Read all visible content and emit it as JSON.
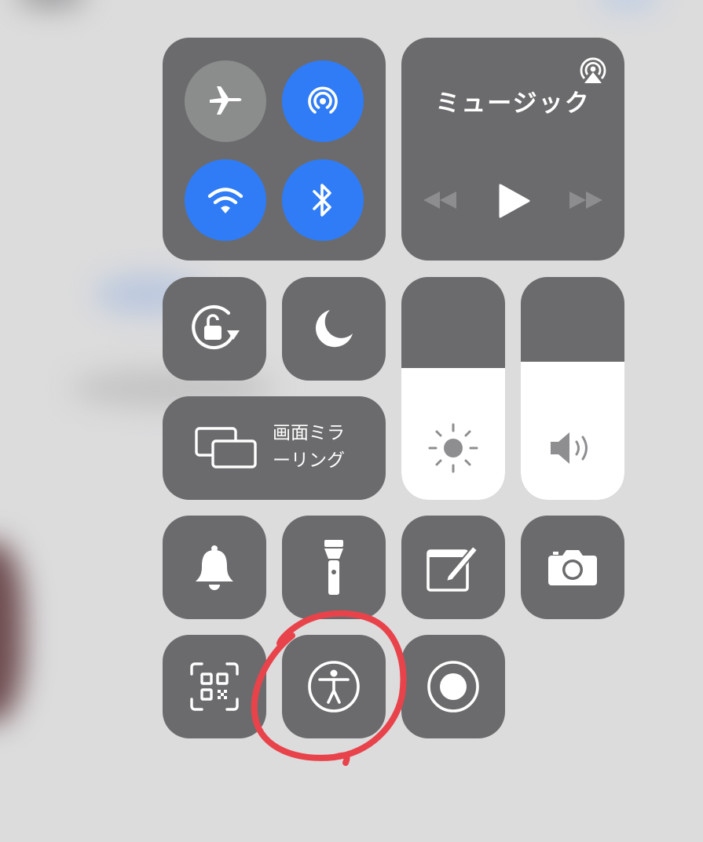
{
  "colors": {
    "background": "#dcdcdd",
    "tile": "#6b6b6d",
    "active_blue": "#2f7cf6",
    "inactive_gray": "#8b8d8c",
    "annotation_red": "#e8434b"
  },
  "connectivity": {
    "airplane": {
      "icon": "airplane-icon",
      "active": false
    },
    "airdrop": {
      "icon": "airdrop-icon",
      "active": true
    },
    "wifi": {
      "icon": "wifi-icon",
      "active": true
    },
    "bluetooth": {
      "icon": "bluetooth-icon",
      "active": true
    }
  },
  "music": {
    "title": "ミュージック",
    "airplay_icon": "airplay-icon",
    "controls": [
      "rewind-icon",
      "play-icon",
      "fast-forward-icon"
    ]
  },
  "toggles": {
    "rotation_lock": {
      "icon": "rotation-lock-icon"
    },
    "do_not_disturb": {
      "icon": "moon-icon"
    }
  },
  "screen_mirroring": {
    "label_line1": "画面ミラ",
    "label_line2": "ーリング",
    "icon": "screen-mirroring-icon"
  },
  "sliders": {
    "brightness": {
      "icon": "sun-icon",
      "level": 0.59
    },
    "volume": {
      "icon": "speaker-icon",
      "level": 0.62
    }
  },
  "controls_row1": [
    "bell-icon",
    "flashlight-icon",
    "notes-icon",
    "camera-icon"
  ],
  "controls_row2": [
    "qr-scanner-icon",
    "accessibility-icon",
    "screen-record-icon"
  ],
  "annotation": {
    "target": "accessibility-button",
    "shape": "red-hand-drawn-circle"
  }
}
